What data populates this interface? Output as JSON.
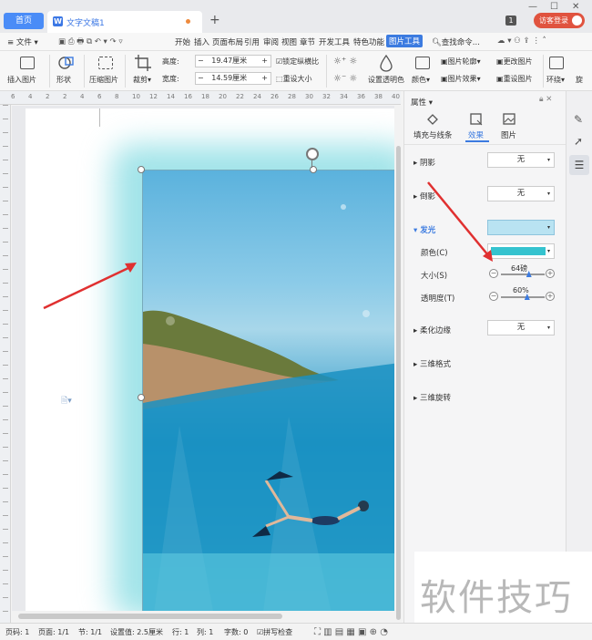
{
  "tabs": {
    "home": "首页",
    "doc_title": "文字文稿1",
    "new_tab": "+"
  },
  "titlebar": {
    "badge": "1",
    "login": "访客登录"
  },
  "menu": {
    "file": "文件",
    "items": [
      "开始",
      "插入",
      "页面布局",
      "引用",
      "审阅",
      "视图",
      "章节",
      "开发工具",
      "特色功能",
      "图片工具"
    ],
    "active": "图片工具",
    "search": "查找命令..."
  },
  "ribbon": {
    "insert_picture": "插入图片",
    "shape": "形状",
    "compress": "压缩图片",
    "crop": "裁剪",
    "height_label": "高度:",
    "height_value": "19.47厘米",
    "width_label": "宽度:",
    "width_value": "14.59厘米",
    "lock_ratio": "锁定纵横比",
    "reset_size": "重设大小",
    "set_transparent": "设置透明色",
    "color": "颜色",
    "outline": "图片轮廓",
    "effects": "图片效果",
    "change_picture": "更改图片",
    "reset_picture": "重设图片",
    "wrap": "环绕",
    "rotate": "旋"
  },
  "ruler": {
    "h": [
      "6",
      "4",
      "2",
      "2",
      "4",
      "6",
      "8",
      "10",
      "12",
      "14",
      "16",
      "18",
      "20",
      "22",
      "24",
      "26",
      "28",
      "30",
      "32",
      "34",
      "36",
      "38",
      "40"
    ]
  },
  "panel": {
    "title": "属性",
    "tabs": [
      "填充与线条",
      "效果",
      "图片"
    ],
    "active_tab": "效果",
    "shadow": {
      "label": "阴影",
      "value": "无"
    },
    "reflection": {
      "label": "倒影",
      "value": "无"
    },
    "glow": {
      "label": "发光",
      "preset_color": "#b9e3f2",
      "color_label": "颜色(C)",
      "color_value": "#35c3cf",
      "size_label": "大小(S)",
      "size_value": "64磅",
      "size_fraction": 0.64,
      "transparency_label": "透明度(T)",
      "transparency_value": "60%",
      "transparency_fraction": 0.6
    },
    "soft_edges": {
      "label": "柔化边缘",
      "value": "无"
    },
    "format_3d": "三维格式",
    "rotation_3d": "三维旋转"
  },
  "status": {
    "page_num": "页码: 1",
    "pages": "页面: 1/1",
    "section": "节: 1/1",
    "setting": "设置值: 2.5厘米",
    "row": "行: 1",
    "col": "列: 1",
    "words": "字数: 0",
    "spell": "拼写检查"
  },
  "watermark": "软件技巧",
  "colors": {
    "accent": "#3c7be0",
    "login": "#e0533f",
    "arrow": "#e03030",
    "glow": "#a2e4e9"
  }
}
